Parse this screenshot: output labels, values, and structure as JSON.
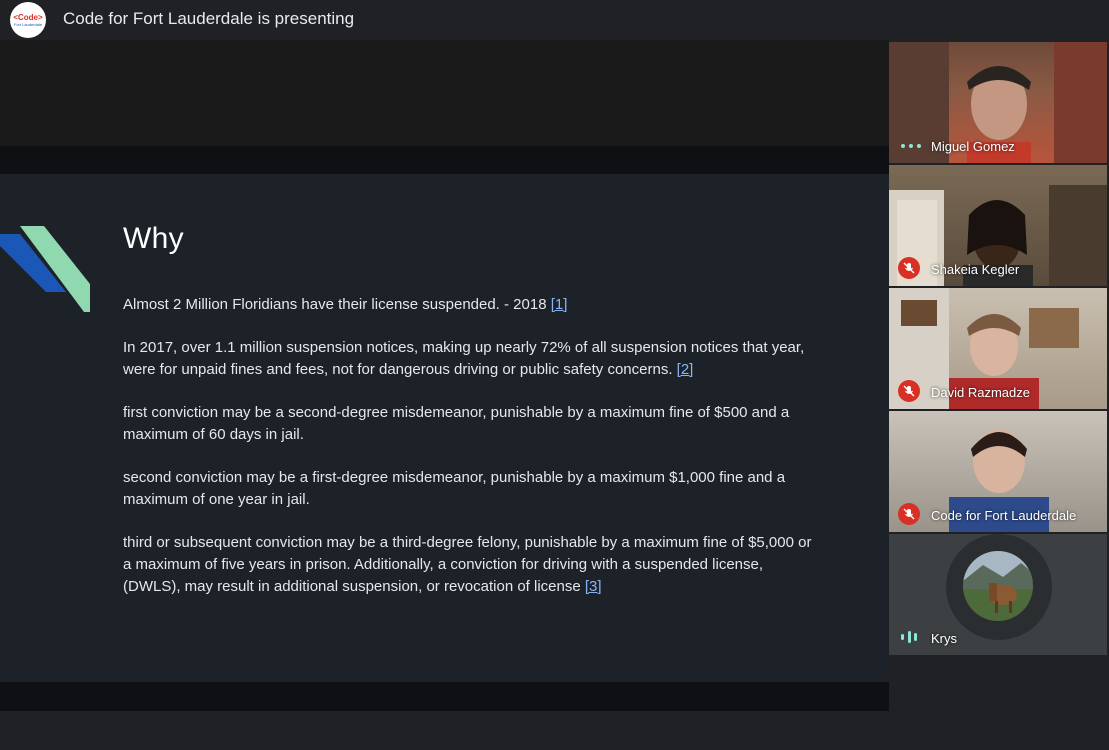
{
  "header": {
    "logo_text_main": "<Code>",
    "logo_text_sub": "Fort Lauderdale",
    "presenting_text": "Code for Fort Lauderdale is presenting"
  },
  "slide": {
    "title": "Why",
    "paragraphs": [
      {
        "text": "Almost 2 Million Floridians have their license suspended. - 2018 ",
        "ref": "[1]"
      },
      {
        "text": "In 2017, over 1.1 million suspension notices, making up nearly 72% of all suspension notices that year, were for unpaid fines and fees, not for dangerous driving or public safety concerns. ",
        "ref": "[2]"
      },
      {
        "text": "first conviction may be a second-degree misdemeanor, punishable by a maximum fine of $500 and a maximum of 60 days in jail.",
        "ref": ""
      },
      {
        "text": "second conviction may be a first-degree misdemeanor, punishable by a maximum $1,000 fine and a maximum of one year in jail.",
        "ref": ""
      },
      {
        "text": "third or subsequent conviction may be a third-degree felony, punishable by a maximum fine of $5,000 or a maximum of five years in prison. Additionally, a conviction for driving with a suspended license, (DWLS), may result in additional suspension, or revocation of license ",
        "ref": "[3]"
      }
    ]
  },
  "participants": [
    {
      "name": "Miguel Gomez",
      "status_icon": "speaking-dots-icon"
    },
    {
      "name": "Shakeia Kegler",
      "status_icon": "mic-off-icon"
    },
    {
      "name": "David Razmadze",
      "status_icon": "mic-off-icon"
    },
    {
      "name": "Code for Fort Lauderdale",
      "status_icon": "mic-off-icon"
    },
    {
      "name": "Krys",
      "status_icon": "audio-bars-icon"
    }
  ],
  "colors": {
    "accent_green": "#8ee4d6",
    "mic_off_red": "#d93025",
    "link_blue": "#8ab4f8",
    "chevron_blue": "#1a57b7",
    "chevron_green": "#8fd8b0"
  }
}
